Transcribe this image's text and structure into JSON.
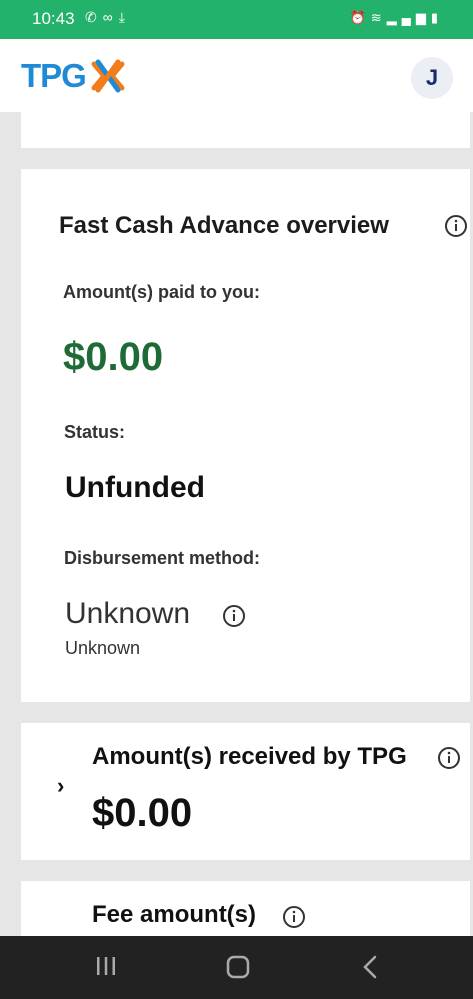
{
  "status_bar": {
    "time": "10:43",
    "left_icons": [
      "phone-icon",
      "voicemail-icon",
      "download-icon"
    ],
    "right_icons": [
      "alarm-icon",
      "wifi-icon",
      "signal-icon",
      "battery-icon"
    ]
  },
  "header": {
    "logo_text": "TPG",
    "avatar_initial": "J"
  },
  "overview": {
    "title": "Fast Cash Advance overview",
    "paid_label": "Amount(s) paid to you:",
    "paid_value": "$0.00",
    "status_label": "Status:",
    "status_value": "Unfunded",
    "method_label": "Disbursement method:",
    "method_value": "Unknown",
    "method_sub": "Unknown"
  },
  "received": {
    "title": "Amount(s) received by TPG",
    "value": "$0.00"
  },
  "fee": {
    "title": "Fee amount(s)"
  },
  "colors": {
    "status_bar": "#23b26b",
    "brand_blue": "#1f8ad6",
    "brand_orange": "#f07d1a",
    "amount_green": "#1f6b37"
  }
}
